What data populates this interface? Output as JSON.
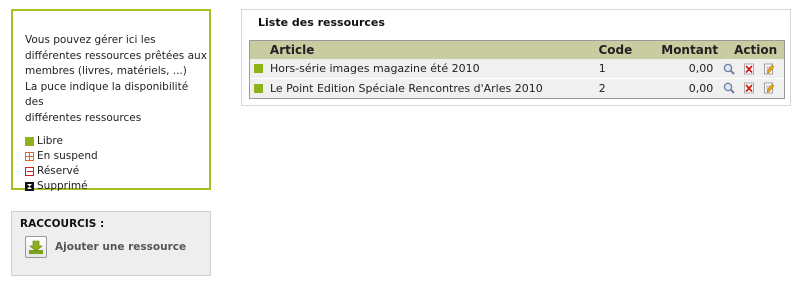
{
  "info": {
    "lines": [
      "Vous pouvez gérer ici les",
      "différentes ressources prêtées aux",
      "membres (livres, matériels, ...)",
      "La puce indique la disponibilité des",
      "différentes ressources"
    ],
    "legend": {
      "libre": "Libre",
      "suspend": "En suspend",
      "reserve": "Réservé",
      "supprime": "Supprimé"
    }
  },
  "shortcuts": {
    "title": "RACCOURCIS :",
    "add_label": "Ajouter une ressource"
  },
  "panel": {
    "title": "Liste des ressources",
    "columns": {
      "article": "Article",
      "code": "Code",
      "montant": "Montant",
      "action": "Action"
    },
    "rows": [
      {
        "article": "Hors-série images magazine été 2010",
        "code": "1",
        "montant": "0,00"
      },
      {
        "article": "Le Point Edition Spéciale Rencontres d'Arles 2010",
        "code": "2",
        "montant": "0,00"
      }
    ]
  },
  "colors": {
    "accent": "#a8bf24",
    "status_libre": "#8db21a",
    "header_bg": "#c9cba0"
  },
  "icons": [
    "download-icon",
    "search-icon",
    "delete-icon",
    "edit-icon"
  ]
}
